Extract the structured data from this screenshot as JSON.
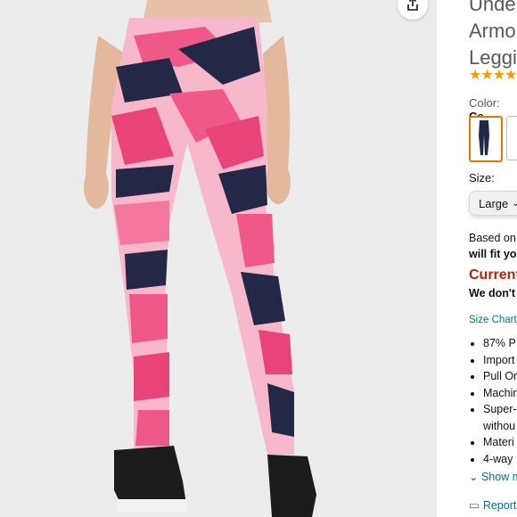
{
  "product": {
    "title": "Unde\nArmo\nLeggi",
    "rating_icon": "star-rating-icon",
    "color_label": "Color: ",
    "color_value": "Ce",
    "size_label": "Size:",
    "size_selected": "Large",
    "fit_text_1": "Based on",
    "fit_text_2": "will fit yo",
    "availability": "Current",
    "availability_note": "We don't",
    "size_chart_link": "Size Chart",
    "bullets": [
      "87% P",
      "Import",
      "Pull Or",
      "Machin",
      "Super-",
      "withou",
      "Materi",
      "4-way"
    ],
    "show_more": "Show m",
    "report": "Report"
  },
  "colors": {
    "accent_orange": "#e77600",
    "star": "#ff9900",
    "link": "#007185",
    "price_red": "#b12704",
    "leggings_pink": "#f0588a",
    "leggings_navy": "#232846"
  }
}
